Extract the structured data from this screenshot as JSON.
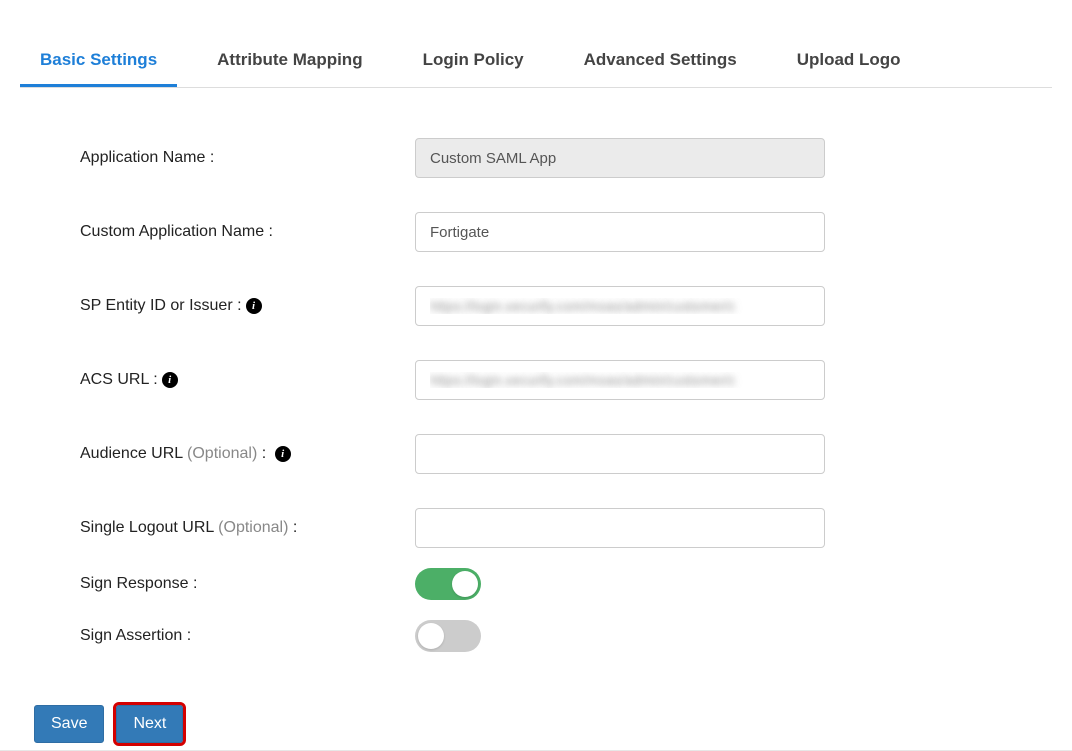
{
  "tabs": {
    "basic": "Basic Settings",
    "attribute": "Attribute Mapping",
    "login": "Login Policy",
    "advanced": "Advanced Settings",
    "upload": "Upload Logo"
  },
  "form": {
    "app_name_label": "Application Name :",
    "app_name_value": "Custom SAML App",
    "custom_name_label": "Custom Application Name :",
    "custom_name_value": "Fortigate",
    "sp_entity_label": "SP Entity ID or Issuer :",
    "sp_entity_value": "https://login.xecurify.com/moas/admin/customer/c",
    "acs_url_label": "ACS URL :",
    "acs_url_value": "https://login.xecurify.com/moas/admin/customer/c",
    "audience_label_pre": "Audience URL ",
    "audience_optional": "(Optional)",
    "audience_label_post": " :",
    "audience_value": "",
    "slo_label_pre": "Single Logout URL ",
    "slo_optional": "(Optional)",
    "slo_label_post": " :",
    "slo_value": "",
    "sign_response_label": "Sign Response :",
    "sign_assertion_label": "Sign Assertion :"
  },
  "buttons": {
    "save": "Save",
    "next": "Next"
  },
  "info_glyph": "i"
}
